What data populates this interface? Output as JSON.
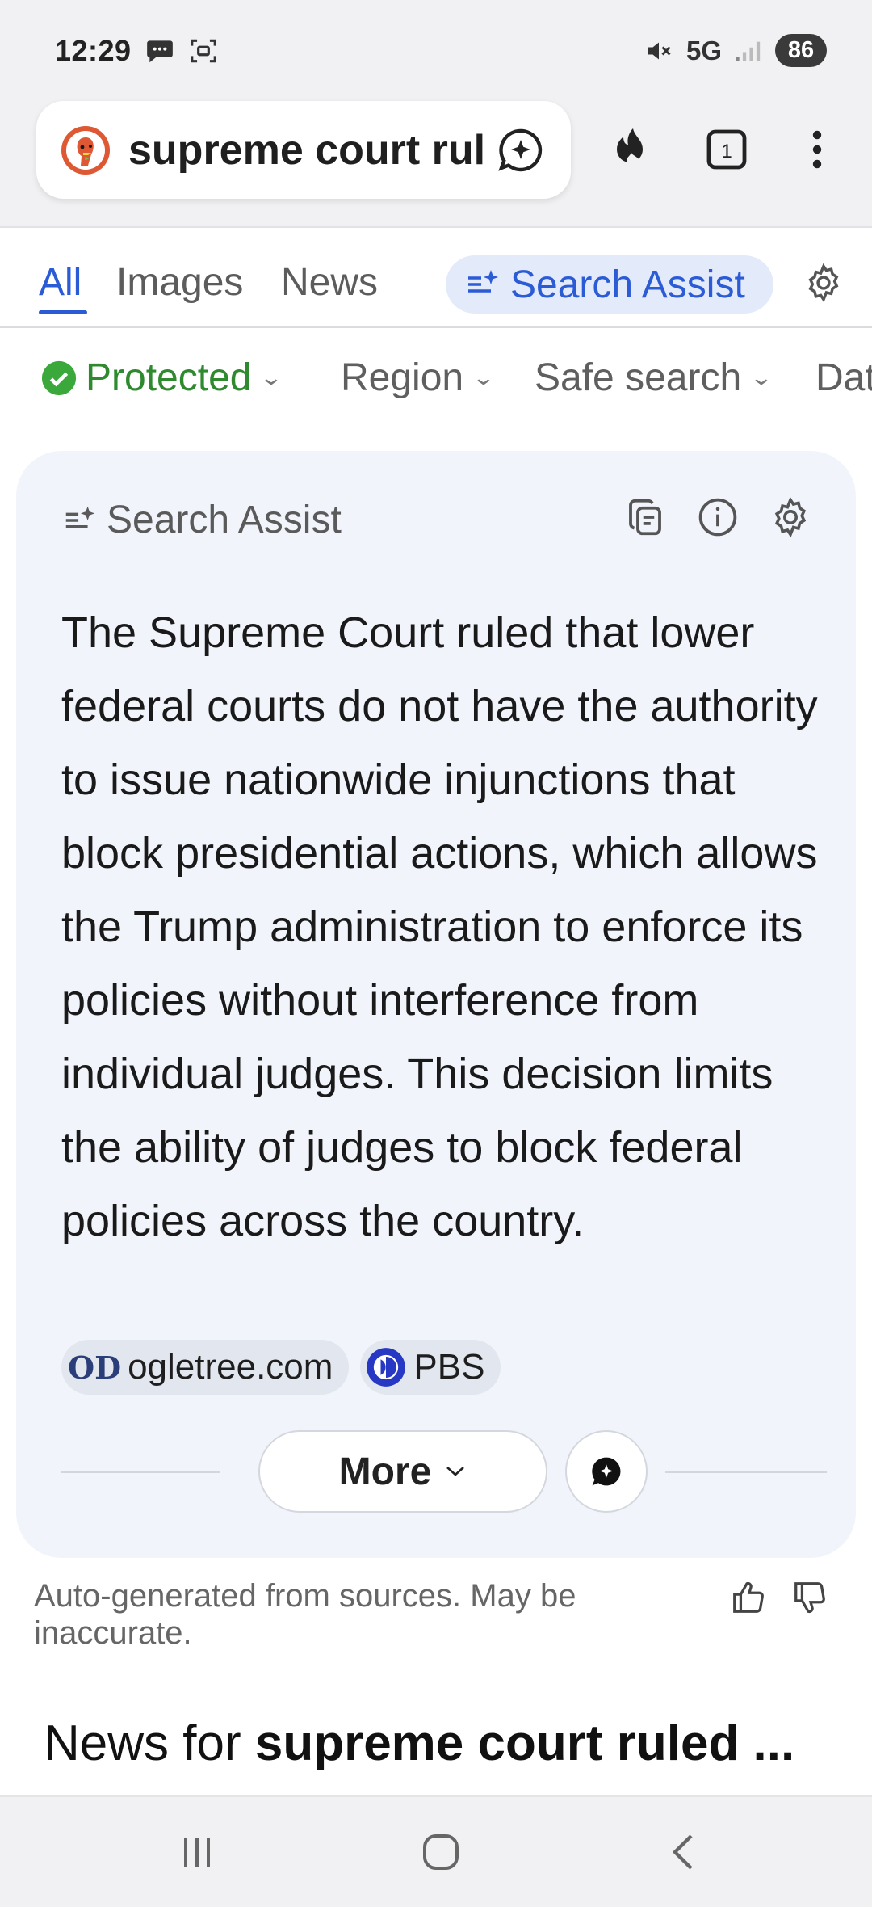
{
  "status_bar": {
    "time": "12:29",
    "network": "5G",
    "battery": "86"
  },
  "address_bar": {
    "query": "supreme court ruled nationwide injunctions"
  },
  "tabs": {
    "all": "All",
    "images": "Images",
    "news": "News",
    "search_assist": "Search Assist"
  },
  "filters": {
    "protected": "Protected",
    "region": "Region",
    "safe_search": "Safe search",
    "date": "Date"
  },
  "assist_card": {
    "title": "Search Assist",
    "body": "The Supreme Court ruled that lower federal courts do not have the authority to issue nationwide injunctions that block presidential actions, which allows the Trump administration to enforce its policies without interference from individual judges. This decision limits the ability of judges to block federal policies across the country.",
    "sources": [
      {
        "logo": "OD",
        "label": "ogletree.com"
      },
      {
        "label": "PBS"
      }
    ],
    "more_label": "More"
  },
  "disclaimer": "Auto-generated from sources. May be inaccurate.",
  "news_heading": {
    "prefix": "News for ",
    "query": "supreme court ruled ..."
  },
  "colors": {
    "accent": "#2c5bd6",
    "protected_green": "#2f8a2f",
    "card_bg": "#f1f4fb",
    "ddg_orange": "#de5833"
  }
}
